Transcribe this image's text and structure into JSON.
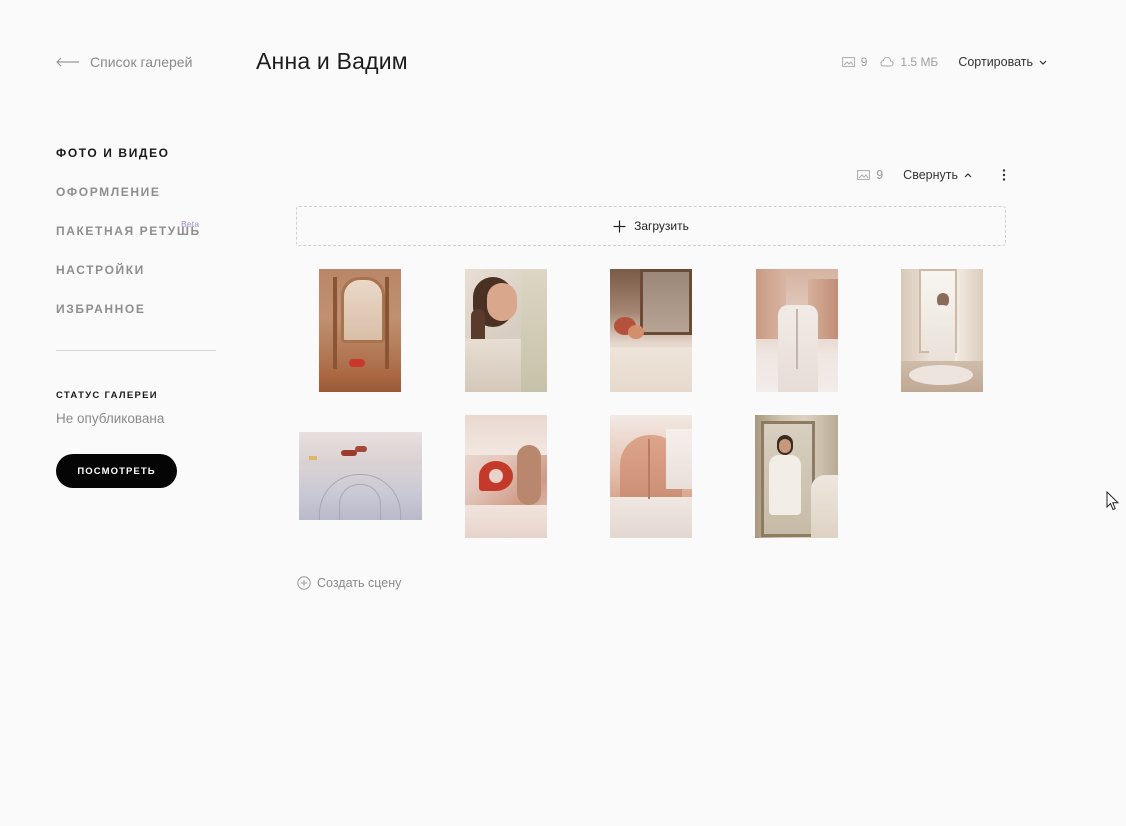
{
  "header": {
    "back_label": "Список галерей",
    "title": "Анна и Вадим",
    "photo_count": "9",
    "storage": "1.5 МБ",
    "sort_label": "Сортировать"
  },
  "sidebar": {
    "items": [
      {
        "label": "ФОТО И ВИДЕО",
        "active": true
      },
      {
        "label": "ОФОРМЛЕНИЕ",
        "active": false
      },
      {
        "label": "ПАКЕТНАЯ РЕТУШЬ",
        "active": false,
        "badge": "Beta"
      },
      {
        "label": "НАСТРОЙКИ",
        "active": false
      },
      {
        "label": "ИЗБРАННОЕ",
        "active": false
      }
    ],
    "status_heading": "СТАТУС ГАЛЕРЕИ",
    "status_value": "Не опубликована",
    "view_button": "ПОСМОТРЕТЬ"
  },
  "section": {
    "photo_count": "9",
    "collapse_label": "Свернуть",
    "upload_label": "Загрузить",
    "create_scene_label": "Создать сцену"
  },
  "photos": [
    {
      "subject": "wedding shoes by mirror"
    },
    {
      "subject": "smiling bride with braided hair"
    },
    {
      "subject": "flowers on table by mirror"
    },
    {
      "subject": "lacing wedding dress"
    },
    {
      "subject": "bride at window"
    },
    {
      "subject": "shoes on floor in sunlight"
    },
    {
      "subject": "red shoe close-up"
    },
    {
      "subject": "back of lace dress"
    },
    {
      "subject": "bride reflected in mirror"
    }
  ]
}
